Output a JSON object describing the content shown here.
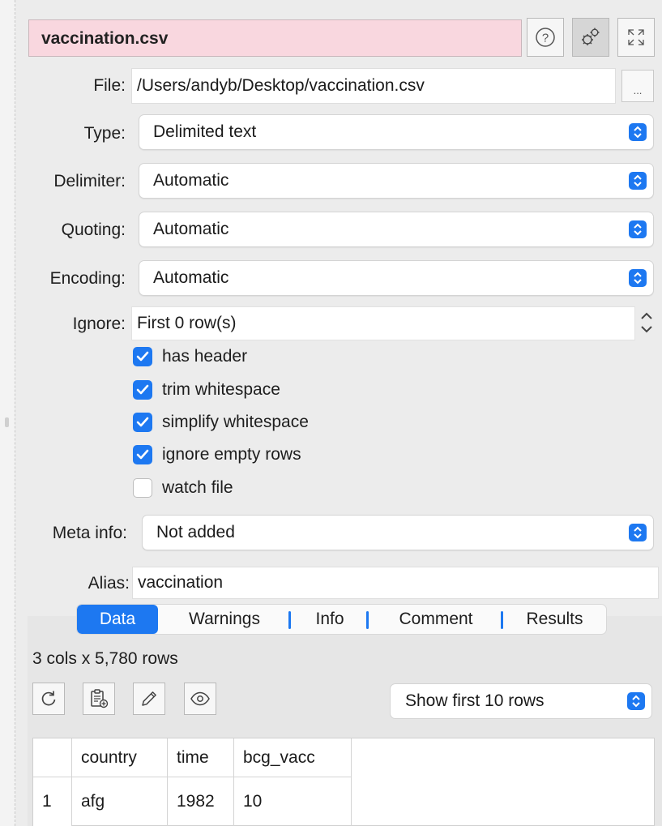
{
  "header": {
    "title": "vaccination.csv"
  },
  "icons": {
    "help": "question-circle-icon",
    "settings": "gears-icon",
    "expand": "expand-arrows-icon",
    "refresh": "refresh-icon",
    "paste": "clipboard-paste-icon",
    "edit": "pencil-icon",
    "preview": "eye-icon"
  },
  "file": {
    "label": "File:",
    "value": "/Users/andyb/Desktop/vaccination.csv",
    "browse": "..."
  },
  "type": {
    "label": "Type:",
    "value": "Delimited text"
  },
  "delimiter": {
    "label": "Delimiter:",
    "value": "Automatic"
  },
  "quoting": {
    "label": "Quoting:",
    "value": "Automatic"
  },
  "encoding": {
    "label": "Encoding:",
    "value": "Automatic"
  },
  "ignore": {
    "label": "Ignore:",
    "value": "First 0 row(s)"
  },
  "options": [
    {
      "label": "has header",
      "checked": true
    },
    {
      "label": "trim whitespace",
      "checked": true
    },
    {
      "label": "simplify whitespace",
      "checked": true
    },
    {
      "label": "ignore empty rows",
      "checked": true
    },
    {
      "label": "watch file",
      "checked": false
    }
  ],
  "meta": {
    "label": "Meta info:",
    "value": "Not added"
  },
  "alias": {
    "label": "Alias:",
    "value": "vaccination"
  },
  "tabs": [
    "Data",
    "Warnings",
    "Info",
    "Comment",
    "Results"
  ],
  "data": {
    "summary": "3 cols x 5,780 rows",
    "show": "Show first 10 rows",
    "columns": [
      "country",
      "time",
      "bcg_vacc"
    ],
    "rows": [
      {
        "index": "1",
        "cells": [
          "afg",
          "1982",
          "10"
        ]
      }
    ]
  },
  "colors": {
    "accent": "#1d78f1",
    "title_bg": "#f9d7df"
  }
}
